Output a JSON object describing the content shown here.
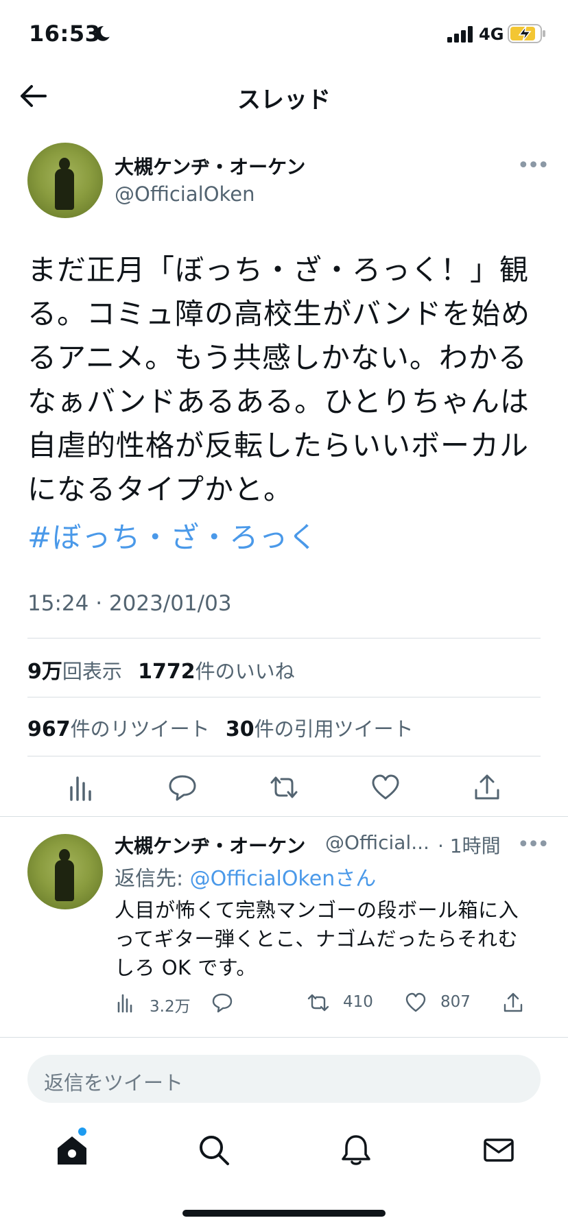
{
  "status_bar": {
    "time": "16:53",
    "network": "4G",
    "moon_icon": "moon-icon",
    "signal_icon": "signal-bars-icon",
    "battery_icon": "battery-charging-icon"
  },
  "header": {
    "title": "スレッド",
    "back_icon": "back-arrow-icon"
  },
  "main_tweet": {
    "author_name": "大槻ケンヂ・オーケン",
    "author_handle": "@OfficialOken",
    "text_lines": [
      "まだ正月「ぼっち・ざ・ろっく！」観",
      "る。コミュ障の高校生がバンドを始め",
      "るアニメ。もう共感しかない。わかる",
      "なぁバンドあるある。ひとりちゃんは",
      "自虐的性格が反転したらいいボーカル",
      "になるタイプかと。"
    ],
    "hashtag": "#ぼっち・ざ・ろっく",
    "timestamp": "15:24 · 2023/01/03",
    "views_count": "9万",
    "views_label": "回表示",
    "likes_count": "1772",
    "likes_label": "件のいいね",
    "retweets_count": "967",
    "retweets_label": "件のリツイート",
    "quotes_count": "30",
    "quotes_label": "件の引用ツイート"
  },
  "reply": {
    "author_name": "大槻ケンヂ・オーケン",
    "author_handle": "@Official...",
    "time": "· 1時間",
    "reply_to_prefix": "返信先:",
    "reply_to_mention": "@OfficialOken",
    "reply_to_suffix": "さん",
    "text_lines": [
      "人目が怖くて完熟マンゴーの段ボール箱に入",
      "ってギター弾くとこ、ナゴムだったらそれむ",
      "しろ OK です。"
    ],
    "views": "3.2万",
    "retweets": "410",
    "likes": "807"
  },
  "composer": {
    "placeholder": "返信をツイート"
  },
  "tab_bar": {
    "items": [
      "home-icon",
      "search-icon",
      "notifications-bell-icon",
      "messages-envelope-icon"
    ]
  }
}
